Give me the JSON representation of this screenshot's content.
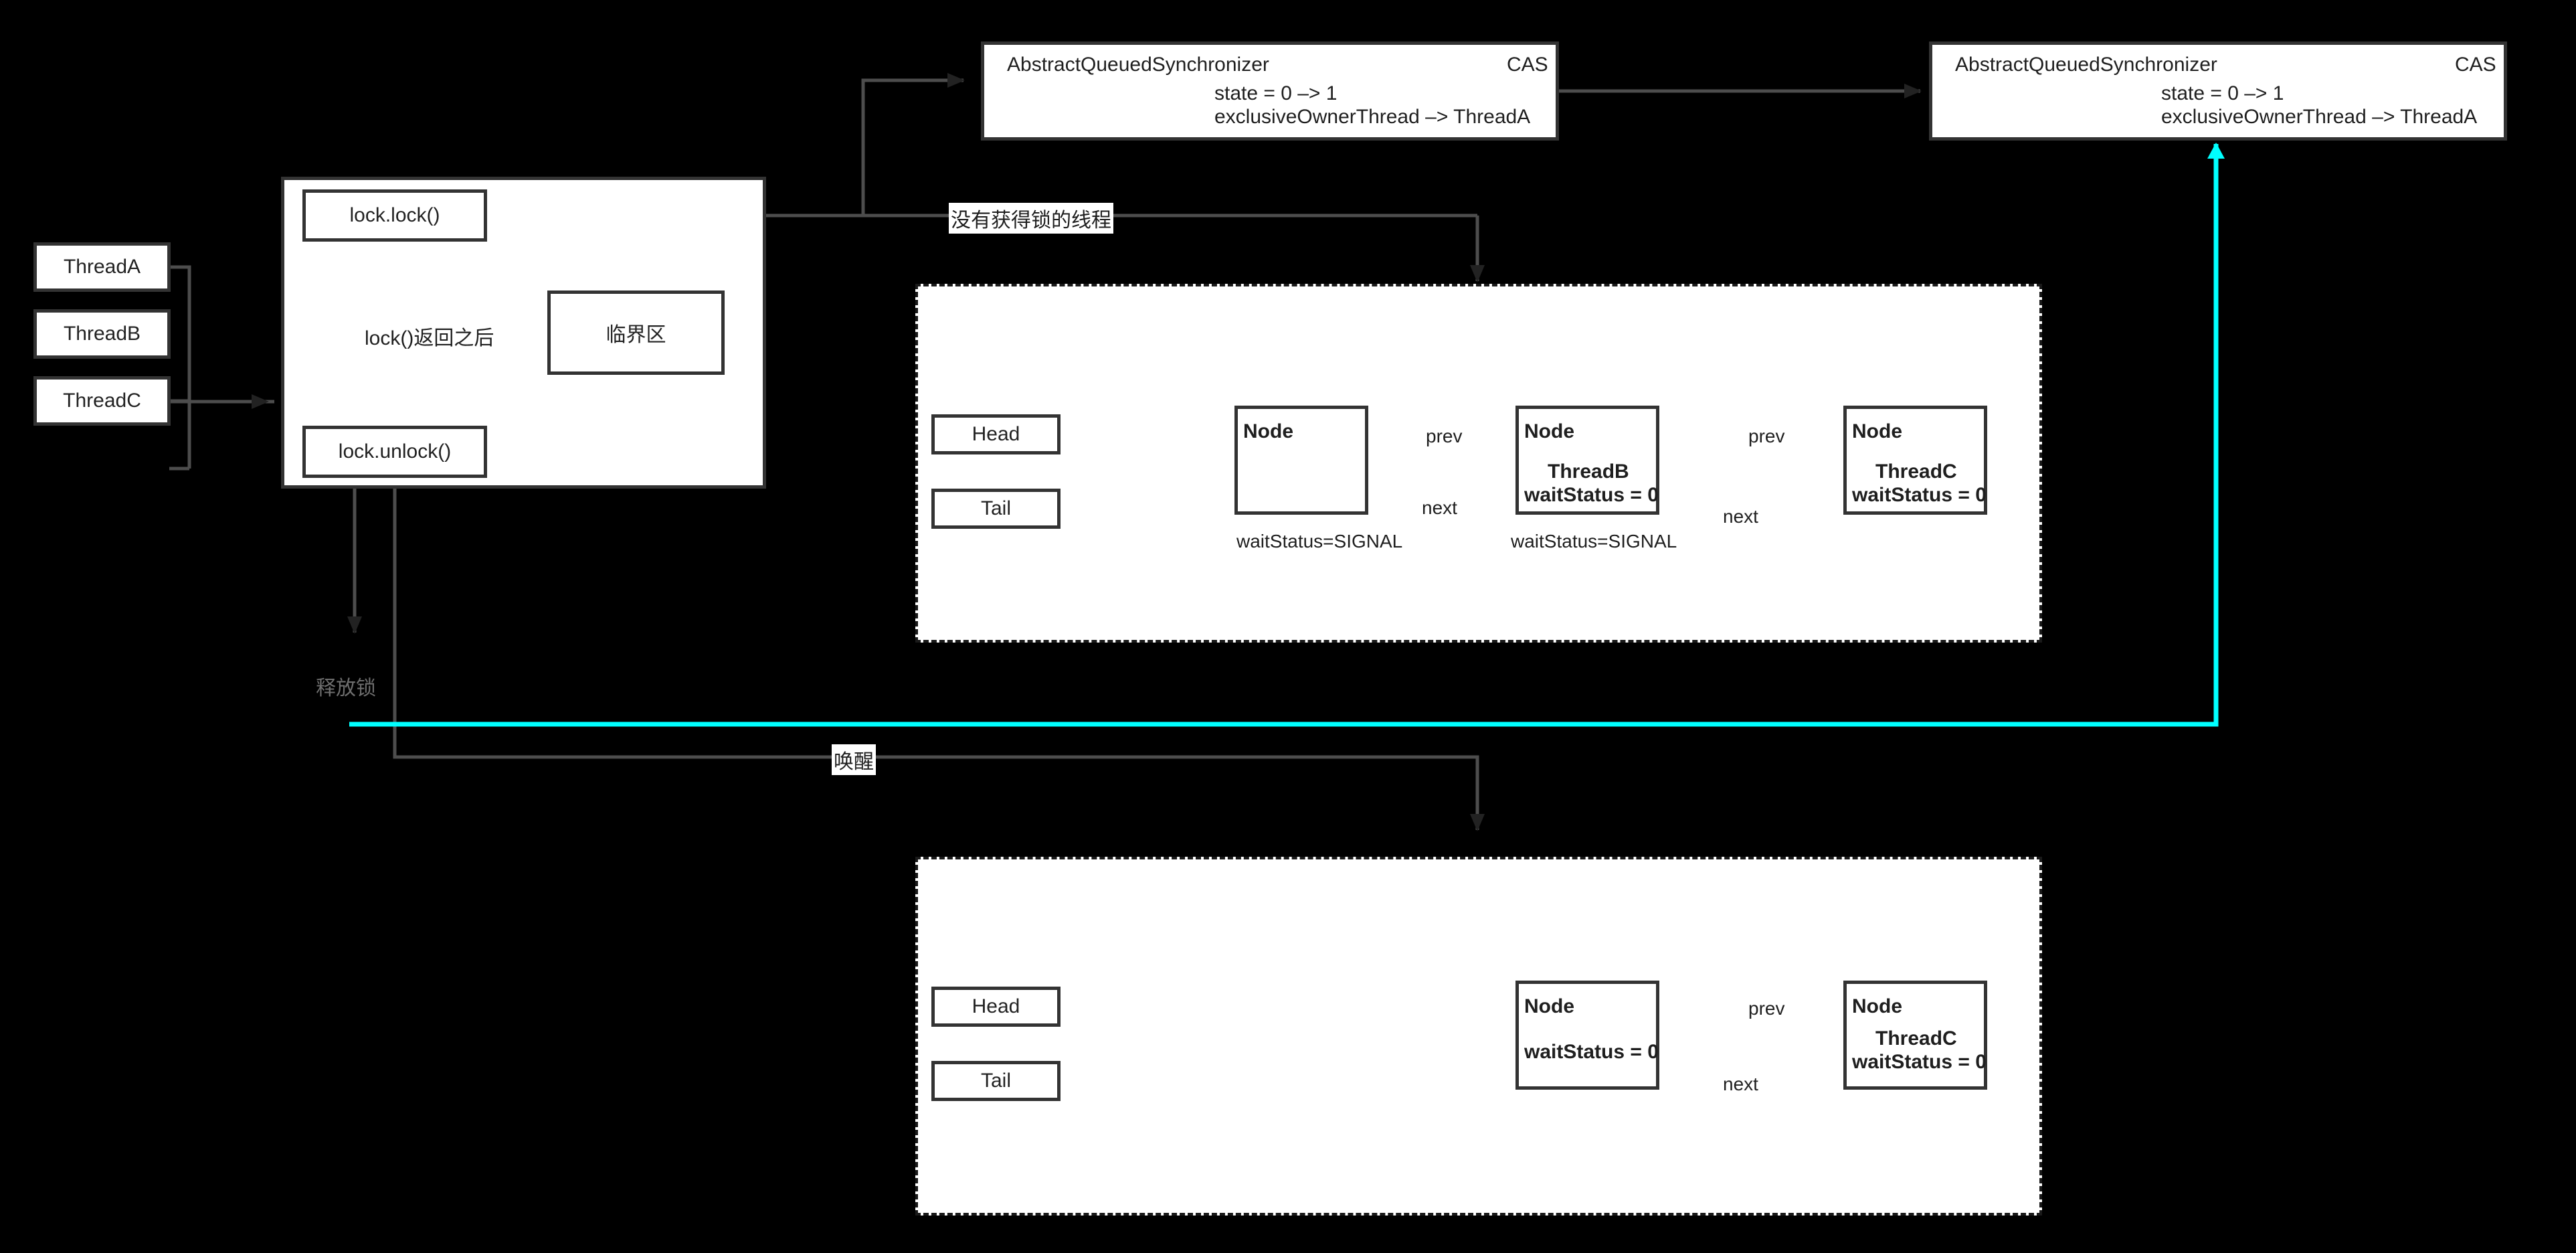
{
  "diagram": {
    "title": "AQS lock acquisition and release flow",
    "colors": {
      "background": "#000000",
      "box_fill": "#ffffff",
      "box_stroke": "#333333",
      "connector": "#4d4d4d",
      "accent_red": "#ff2020",
      "accent_cyan": "#00ffff",
      "text": "#1f1f1f",
      "dim_text": "#6e6e6e"
    }
  },
  "aqs_boxes": [
    {
      "id": "aqs-1",
      "class_name": "AbstractQueuedSynchronizer",
      "operation": "CAS",
      "state_line": "state = 0 –> 1",
      "owner_line": "exclusiveOwnerThread –> ThreadA"
    },
    {
      "id": "aqs-2",
      "class_name": "AbstractQueuedSynchronizer",
      "operation": "CAS",
      "state_line": "state = 0 –> 1",
      "owner_line": "exclusiveOwnerThread –> ThreadA"
    }
  ],
  "threads": [
    {
      "label": "ThreadA"
    },
    {
      "label": "ThreadB"
    },
    {
      "label": "ThreadC"
    }
  ],
  "lock_panel": {
    "lock_label": "lock.lock()",
    "unlock_label": "lock.unlock()",
    "critical_section_label": "临界区",
    "after_lock_returns_label": "lock()返回之后"
  },
  "connector_labels": {
    "no_lock_threads": "没有获得锁的线程",
    "release_lock": "释放锁",
    "wakeup": "唤醒"
  },
  "queues": [
    {
      "id": "queue-upper",
      "head_label": "Head",
      "tail_label": "Tail",
      "nodes": [
        {
          "title": "Node",
          "thread": "",
          "wait_status_inner": "",
          "wait_status_outer": "waitStatus=SIGNAL"
        },
        {
          "title": "Node",
          "thread": "ThreadB",
          "wait_status_inner": "waitStatus = 0",
          "wait_status_outer": "waitStatus=SIGNAL"
        },
        {
          "title": "Node",
          "thread": "ThreadC",
          "wait_status_inner": "waitStatus = 0",
          "wait_status_outer": ""
        }
      ],
      "link_labels": {
        "prev": "prev",
        "next": "next"
      }
    },
    {
      "id": "queue-lower",
      "head_label": "Head",
      "tail_label": "Tail",
      "nodes": [
        {
          "title": "Node",
          "thread": "",
          "wait_status_inner": "waitStatus = 0",
          "wait_status_outer": ""
        },
        {
          "title": "Node",
          "thread": "ThreadC",
          "wait_status_inner": "waitStatus = 0",
          "wait_status_outer": ""
        }
      ],
      "link_labels": {
        "prev": "prev",
        "next": "next"
      }
    }
  ]
}
